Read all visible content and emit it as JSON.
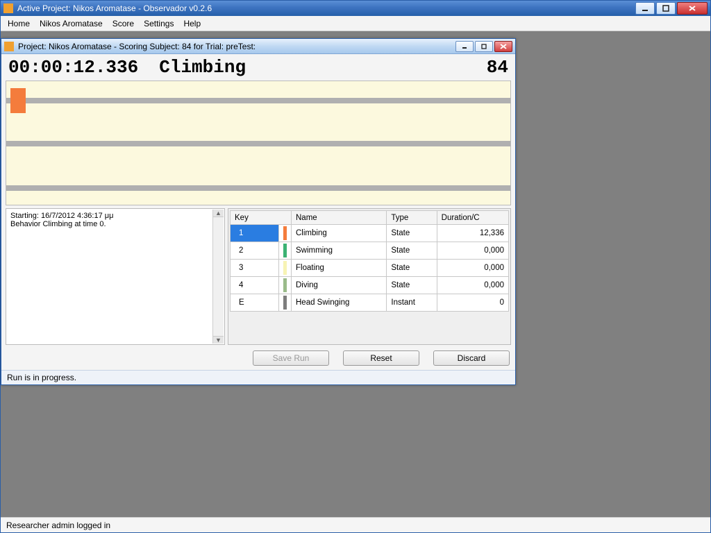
{
  "app": {
    "title": "Active Project: Nikos Aromatase - Observador v0.2.6"
  },
  "menubar": {
    "items": [
      "Home",
      "Nikos Aromatase",
      "Score",
      "Settings",
      "Help"
    ]
  },
  "statusbar": {
    "text": "Researcher admin logged in"
  },
  "child": {
    "title": "Project: Nikos Aromatase - Scoring Subject: 84 for Trial: preTest:",
    "footer": "Run is in progress.",
    "readout": {
      "time": "00:00:12.336",
      "behavior": "Climbing",
      "subject": "84"
    },
    "log": {
      "line1": "Starting: 16/7/2012 4:36:17 μμ",
      "line2": "Behavior Climbing at time 0."
    },
    "buttons": {
      "save": "Save Run",
      "reset": "Reset",
      "discard": "Discard"
    },
    "table": {
      "headers": {
        "key": "Key",
        "name": "Name",
        "type": "Type",
        "duration": "Duration/C"
      },
      "rows": [
        {
          "key": "1",
          "color": "#f47c3c",
          "name": "Climbing",
          "type": "State",
          "duration": "12,336",
          "selected": true
        },
        {
          "key": "2",
          "color": "#3bb273",
          "name": "Swimming",
          "type": "State",
          "duration": "0,000",
          "selected": false
        },
        {
          "key": "3",
          "color": "#f7f3b4",
          "name": "Floating",
          "type": "State",
          "duration": "0,000",
          "selected": false
        },
        {
          "key": "4",
          "color": "#9abb8a",
          "name": "Diving",
          "type": "State",
          "duration": "0,000",
          "selected": false
        },
        {
          "key": "E",
          "color": "#7d7d7d",
          "name": "Head Swinging",
          "type": "Instant",
          "duration": "0",
          "selected": false
        }
      ]
    }
  }
}
